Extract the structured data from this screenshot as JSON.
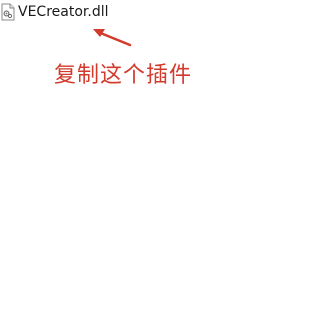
{
  "file": {
    "name": "VECreator.dll",
    "icon": "dll-file-icon"
  },
  "annotation": {
    "text": "复制这个插件",
    "color": "#d23a2c"
  }
}
